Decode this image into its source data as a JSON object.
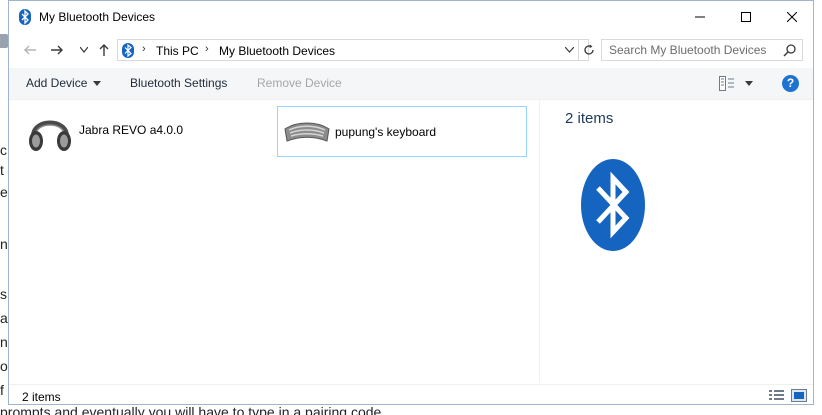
{
  "window": {
    "title": "My Bluetooth Devices"
  },
  "address_bar": {
    "crumbs": [
      "This PC",
      "My Bluetooth Devices"
    ]
  },
  "search": {
    "placeholder": "Search My Bluetooth Devices"
  },
  "command_bar": {
    "add_device": "Add Device",
    "bluetooth_settings": "Bluetooth Settings",
    "remove_device": "Remove Device",
    "help": "?"
  },
  "devices": [
    {
      "name": "Jabra REVO a4.0.0",
      "icon": "headphones-icon",
      "selected": false
    },
    {
      "name": "pupung's keyboard",
      "icon": "keyboard-icon",
      "selected": true
    }
  ],
  "details_pane": {
    "count": "2 items",
    "icon": "bluetooth-logo-icon",
    "accent": "#1565c0"
  },
  "status_bar": {
    "count": "2 items"
  },
  "background_text": {
    "bottom": "prompts and eventually you will have to type in a pairing code"
  }
}
